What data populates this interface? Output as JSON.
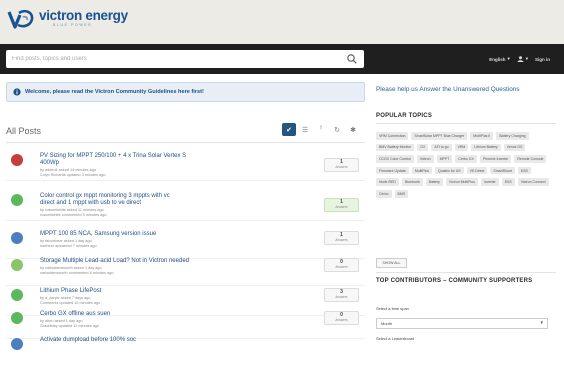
{
  "brand": {
    "name": "victron energy",
    "tagline": "BLUE POWER"
  },
  "search": {
    "placeholder": "Find posts, topics and users"
  },
  "nav": {
    "language": "English",
    "user": "Sign in"
  },
  "banner": {
    "text": "Welcome, please read the Victron Community Guidelines here first!"
  },
  "posts_header": {
    "title": "All Posts"
  },
  "posts": [
    {
      "title_lines": [
        "PV Sizing for MPPT 250/100 + 4 x Trina Solar Vertex S",
        "400Wp"
      ],
      "meta_lines": [
        "by added1 asked 14 minutes ago",
        "Colyn Richards updated 3 minutes ago"
      ],
      "count": "1",
      "label": "Answers",
      "icon_color": "#c2403a",
      "answered": false
    },
    {
      "title_lines": [
        "Color control gx mppt monitoring 3 mppts with vc",
        "direct and 1 mppt with usb to ve direct"
      ],
      "meta_lines": [
        "by roswellwhite asked 11 minutes ago",
        "roswellwhite commented 3 minutes ago"
      ],
      "count": "1",
      "label": "Answers",
      "icon_color": "#5cb85c",
      "answered": true
    },
    {
      "title_lines": [
        "MPPT 100 85 NCA, Samsung version issue"
      ],
      "meta_lines": [
        "by falconbear asked 1 day ago",
        "northern answered 7 minutes ago"
      ],
      "count": "1",
      "label": "Answers",
      "icon_color": "#4b7fc0",
      "answered": false
    },
    {
      "title_lines": [
        "Storage Multiple Lead-acid Load? Not in Victron needed"
      ],
      "meta_lines": [
        "by carlosfamsworth asked 1 day ago",
        "carlosfamsworth commented 8 minutes ago"
      ],
      "count": "0",
      "label": "Answers",
      "icon_color": "#8ac56a",
      "answered": false
    },
    {
      "title_lines": [
        "Lithium Phase LifePost"
      ],
      "meta_lines": [
        "by d_daryle asked 7 days ago",
        "Comments updated 10 minutes ago"
      ],
      "count": "3",
      "label": "Answers",
      "icon_color": "#5cb85c",
      "answered": false
    },
    {
      "title_lines": [
        "Cerbo GX offline aus suen"
      ],
      "meta_lines": [
        "by aheu asked 1 day ago",
        "Graddetsy updated 11 minutes ago"
      ],
      "count": "0",
      "label": "Answers",
      "icon_color": "#5cb85c",
      "answered": false
    },
    {
      "title_lines": [
        "Activate dumpload before 100% soc"
      ],
      "meta_lines": [],
      "count": "",
      "label": "",
      "icon_color": "#4b7fc0",
      "answered": false
    }
  ],
  "sidebar": {
    "help_link": "Please help us Answer the Unanswered Questions",
    "popular_topics_heading": "POPULAR TOPICS",
    "tags": [
      "VRM Connection",
      "SmartSolar MPPT Blue Charger",
      "MultiPlus II",
      "Battery Charging",
      "BMV Battery Monitor",
      "GX",
      "AFI to go",
      "VRM",
      "Lithium Battery",
      "Venus OS",
      "CCGX Color Control",
      "Victron",
      "MPPT",
      "Cerbo GX",
      "Phoenix Inverter",
      "Remote Console",
      "Firmware Update",
      "MultiPlus",
      "Quattro for US",
      "VE.Direct",
      "SmartShunt",
      "ESS",
      "Node-RED",
      "Bluetooth",
      "Battery",
      "Victron MultiPlus",
      "Inverter",
      "ESS",
      "Victron Connect",
      "Cerbo",
      "BMS"
    ],
    "show_all": "SHOW ALL",
    "contributors_heading": "TOP CONTRIBUTORS – COMMUNITY SUPPORTERS",
    "time_label": "Select a time span",
    "time_value": "Month",
    "leaderboard_label": "Select a Leaderboard"
  },
  "colors": {
    "brand_blue": "#1a5292",
    "topbar": "#ecebe6",
    "searchbar": "#1f1f1f",
    "link_blue": "#1f4f86",
    "active_tab": "#24557f"
  }
}
